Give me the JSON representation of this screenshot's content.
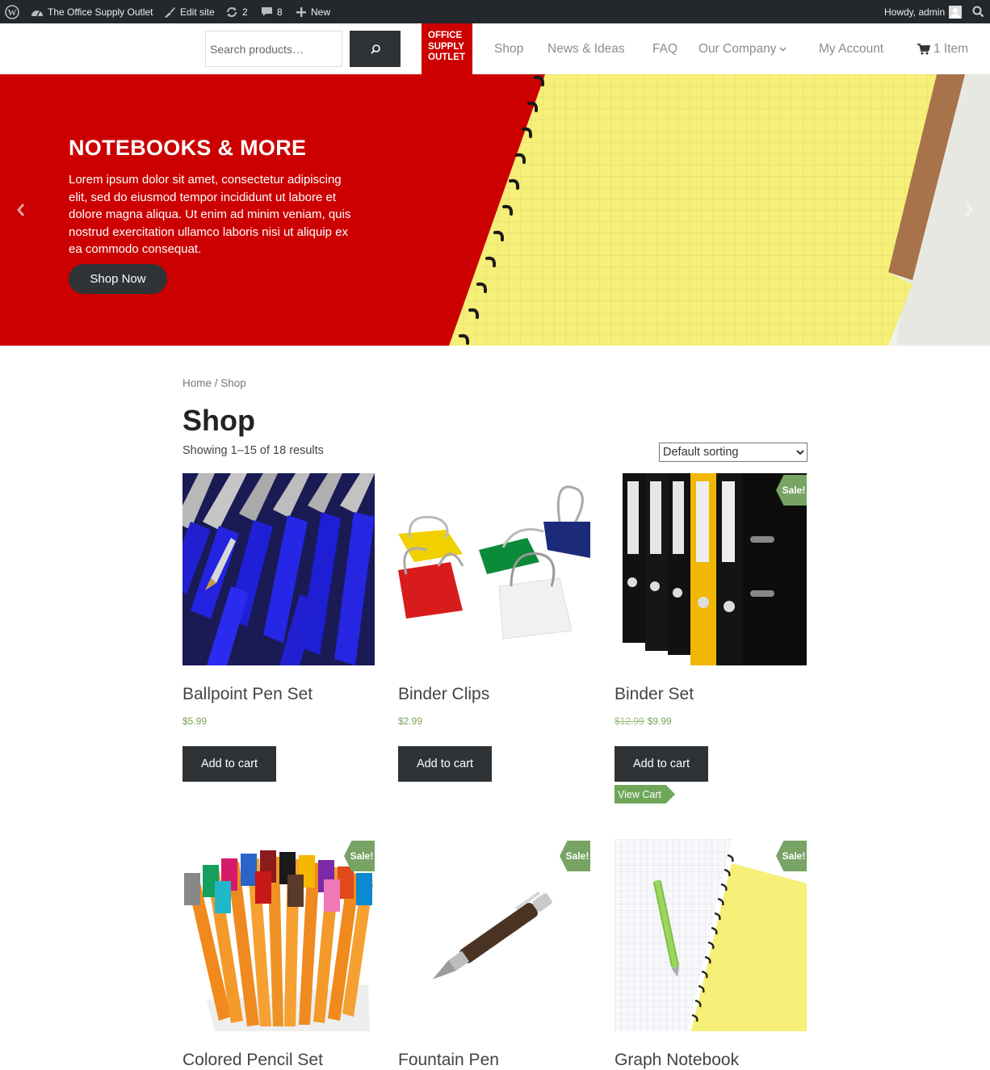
{
  "admin_bar": {
    "site_name": "The Office Supply Outlet",
    "edit_site": "Edit site",
    "updates_count": "2",
    "comments_count": "8",
    "new_label": "New",
    "howdy": "Howdy, admin"
  },
  "header": {
    "search_placeholder": "Search products…",
    "logo_lines": [
      "OFFICE",
      "SUPPLY",
      "OUTLET"
    ],
    "nav": {
      "shop": "Shop",
      "news": "News & Ideas",
      "faq": "FAQ",
      "company": "Our Company",
      "account": "My Account",
      "cart": "1 Item"
    }
  },
  "hero": {
    "title": "NOTEBOOKS & MORE",
    "text": "Lorem ipsum dolor sit amet, consectetur adipiscing elit, sed do eiusmod tempor incididunt ut labore et dolore magna aliqua. Ut enim ad minim veniam, quis nostrud exercitation ullamco laboris nisi ut aliquip ex ea commodo consequat.",
    "button": "Shop Now"
  },
  "shop": {
    "breadcrumb": "Home / Shop",
    "title": "Shop",
    "result_count": "Showing 1–15 of 18 results",
    "sorting_selected": "Default sorting",
    "add_to_cart": "Add to cart",
    "view_cart": "View Cart",
    "sale_badge": "Sale!",
    "products": [
      {
        "name": "Ballpoint Pen Set",
        "price": "$5.99",
        "old_price": ""
      },
      {
        "name": "Binder Clips",
        "price": "$2.99",
        "old_price": ""
      },
      {
        "name": "Binder Set",
        "price": "$9.99",
        "old_price": "$12.99"
      },
      {
        "name": "Colored Pencil Set",
        "price": "",
        "old_price": ""
      },
      {
        "name": "Fountain Pen",
        "price": "",
        "old_price": ""
      },
      {
        "name": "Graph Notebook",
        "price": "",
        "old_price": ""
      }
    ]
  }
}
